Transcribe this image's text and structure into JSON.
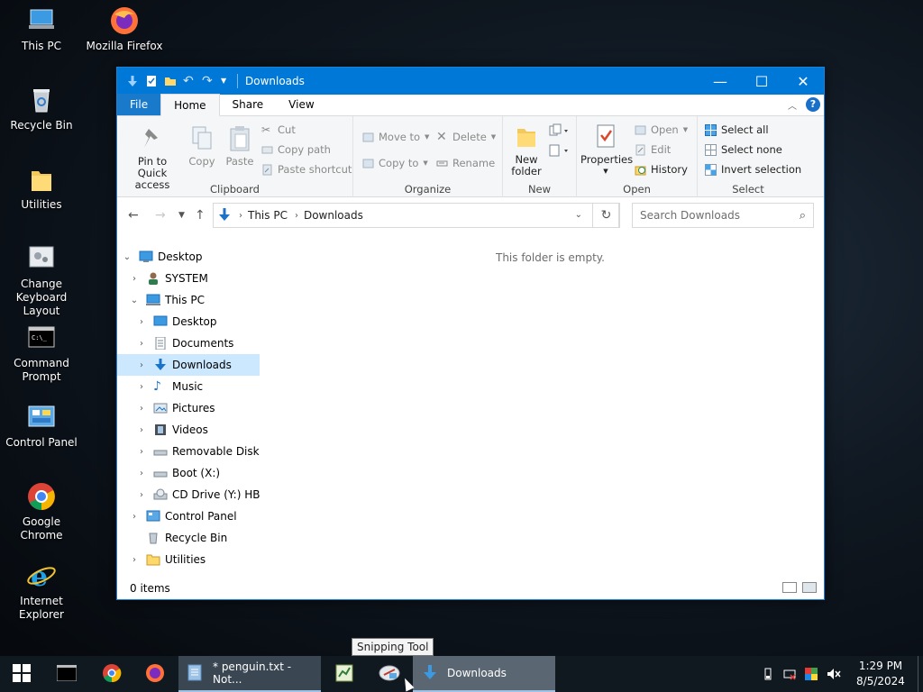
{
  "desktop": {
    "icons": [
      {
        "label": "This PC",
        "icon": "this-pc-icon"
      },
      {
        "label": "Mozilla Firefox",
        "icon": "firefox-icon"
      },
      {
        "label": "Recycle Bin",
        "icon": "recycle-bin-icon"
      },
      {
        "label": "Utilities",
        "icon": "folder-icon"
      },
      {
        "label": "Change Keyboard Layout",
        "icon": "keyboard-layout-icon"
      },
      {
        "label": "Command Prompt",
        "icon": "cmd-icon"
      },
      {
        "label": "Control Panel",
        "icon": "control-panel-icon"
      },
      {
        "label": "Google Chrome",
        "icon": "chrome-icon"
      },
      {
        "label": "Internet Explorer",
        "icon": "ie-icon"
      }
    ]
  },
  "window": {
    "title": "Downloads",
    "tabs": [
      "File",
      "Home",
      "Share",
      "View"
    ],
    "active_tab": "Home",
    "ribbon": {
      "clipboard": {
        "label": "Clipboard",
        "pin": "Pin to Quick access",
        "copy": "Copy",
        "paste": "Paste",
        "cut": "Cut",
        "copy_path": "Copy path",
        "paste_shortcut": "Paste shortcut"
      },
      "organize": {
        "label": "Organize",
        "move_to": "Move to",
        "copy_to": "Copy to",
        "delete": "Delete",
        "rename": "Rename"
      },
      "new": {
        "label": "New",
        "new_folder": "New folder"
      },
      "open": {
        "label": "Open",
        "properties": "Properties",
        "open": "Open",
        "edit": "Edit",
        "history": "History"
      },
      "select": {
        "label": "Select",
        "select_all": "Select all",
        "select_none": "Select none",
        "invert": "Invert selection"
      }
    },
    "address": {
      "crumbs": [
        "This PC",
        "Downloads"
      ],
      "search_placeholder": "Search Downloads"
    },
    "tree": [
      {
        "label": "Desktop",
        "level": 0,
        "expanded": true,
        "icon": "desktop-icon"
      },
      {
        "label": "SYSTEM",
        "level": 1,
        "expanded": false,
        "icon": "user-icon"
      },
      {
        "label": "This PC",
        "level": 1,
        "expanded": true,
        "icon": "this-pc-icon"
      },
      {
        "label": "Desktop",
        "level": 2,
        "expanded": false,
        "icon": "desktop-icon"
      },
      {
        "label": "Documents",
        "level": 2,
        "expanded": false,
        "icon": "documents-icon"
      },
      {
        "label": "Downloads",
        "level": 2,
        "expanded": false,
        "icon": "downloads-icon",
        "selected": true
      },
      {
        "label": "Music",
        "level": 2,
        "expanded": false,
        "icon": "music-icon"
      },
      {
        "label": "Pictures",
        "level": 2,
        "expanded": false,
        "icon": "pictures-icon"
      },
      {
        "label": "Videos",
        "level": 2,
        "expanded": false,
        "icon": "videos-icon"
      },
      {
        "label": "Removable Disk (C",
        "level": 2,
        "expanded": false,
        "icon": "drive-icon"
      },
      {
        "label": "Boot (X:)",
        "level": 2,
        "expanded": false,
        "icon": "drive-icon"
      },
      {
        "label": "CD Drive (Y:) HBC",
        "level": 2,
        "expanded": false,
        "icon": "cd-drive-icon"
      },
      {
        "label": "Control Panel",
        "level": 1,
        "expanded": false,
        "icon": "control-panel-icon"
      },
      {
        "label": "Recycle Bin",
        "level": 1,
        "expanded": null,
        "icon": "recycle-bin-icon"
      },
      {
        "label": "Utilities",
        "level": 1,
        "expanded": false,
        "icon": "folder-icon"
      }
    ],
    "empty_message": "This folder is empty.",
    "status": "0 items"
  },
  "taskbar": {
    "notepad_task": "* penguin.txt - Not...",
    "downloads_task": "Downloads",
    "tooltip": "Snipping Tool",
    "time": "1:29 PM",
    "date": "8/5/2024"
  },
  "colors": {
    "titlebar": "#0078d7",
    "selection": "#cce8ff",
    "file_tab": "#1979ca"
  }
}
